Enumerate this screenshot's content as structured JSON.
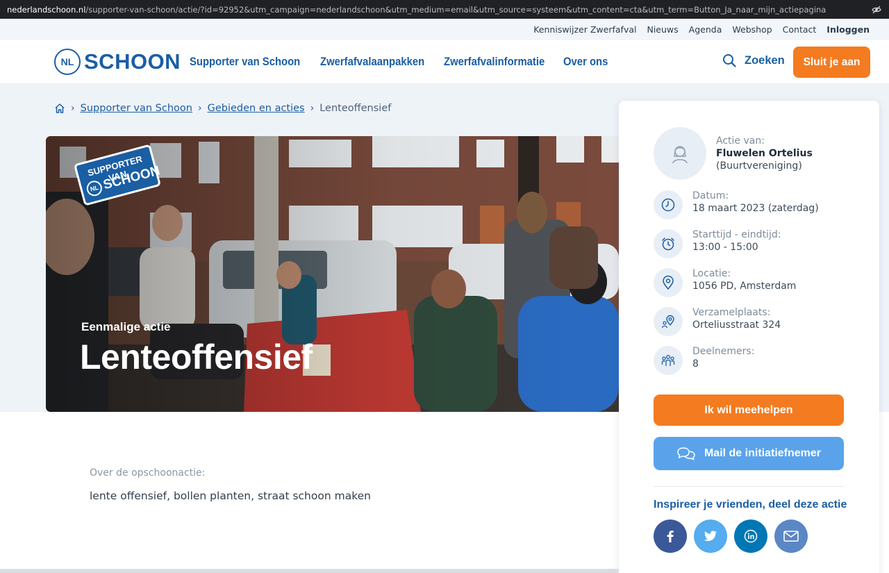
{
  "browser": {
    "url_host": "nederlandschoon.nl",
    "url_path": "/supporter-van-schoon/actie/?id=92952&utm_campaign=nederlandschoon&utm_medium=email&utm_source=systeem&utm_content=cta&utm_term=Button_Ja_naar_mijn_actiepagina",
    "privacy_icon": "eye-off-icon"
  },
  "utility_nav": {
    "items": [
      "Kenniswijzer Zwerfafval",
      "Nieuws",
      "Agenda",
      "Webshop",
      "Contact"
    ],
    "login": "Inloggen"
  },
  "header": {
    "logo_mark": "NL",
    "logo_text": "SCHOON",
    "nav": [
      "Supporter van Schoon",
      "Zwerfafvalaanpakken",
      "Zwerfafvalinformatie",
      "Over ons"
    ],
    "search_label": "Zoeken",
    "join_button": "Sluit je aan"
  },
  "breadcrumb": {
    "home_icon": "home-icon",
    "items": [
      "Supporter van Schoon",
      "Gebieden en acties"
    ],
    "current": "Lenteoffensief"
  },
  "hero": {
    "badge_line1": "SUPPORTER VAN",
    "badge_mark": "NL",
    "badge_line2": "SCHOON",
    "subtitle": "Eenmalige actie",
    "title": "Lenteoffensief"
  },
  "sidebar": {
    "actie_label": "Actie van:",
    "actie_name": "Fluwelen Ortelius",
    "actie_type": "(Buurtvereniging)",
    "details": [
      {
        "icon": "clock-icon",
        "label": "Datum:",
        "value": "18 maart 2023 (zaterdag)"
      },
      {
        "icon": "alarm-clock-icon",
        "label": "Starttijd - eindtijd:",
        "value": "13:00 - 15:00"
      },
      {
        "icon": "location-pin-icon",
        "label": "Locatie:",
        "value": "1056 PD, Amsterdam"
      },
      {
        "icon": "meeting-point-icon",
        "label": "Verzamelplaats:",
        "value": "Orteliusstraat 324"
      },
      {
        "icon": "participants-icon",
        "label": "Deelnemers:",
        "value": "8"
      }
    ],
    "help_button": "Ik wil meehelpen",
    "mail_button": "Mail de initiatiefnemer",
    "share_title": "Inspireer je vrienden, deel deze actie",
    "share": [
      {
        "icon": "facebook-icon",
        "color": "#3b5998"
      },
      {
        "icon": "twitter-icon",
        "color": "#55acee"
      },
      {
        "icon": "linkedin-icon",
        "color": "#0077b5"
      },
      {
        "icon": "mail-icon",
        "color": "#5b87c5"
      }
    ]
  },
  "about": {
    "label": "Over de opschoonactie:",
    "text": "lente offensief, bollen planten, straat schoon maken"
  },
  "colors": {
    "brand_blue": "#1a5ea4",
    "accent_orange": "#f47b20",
    "mail_blue": "#5aa3ea",
    "band": "#eef3f8"
  }
}
